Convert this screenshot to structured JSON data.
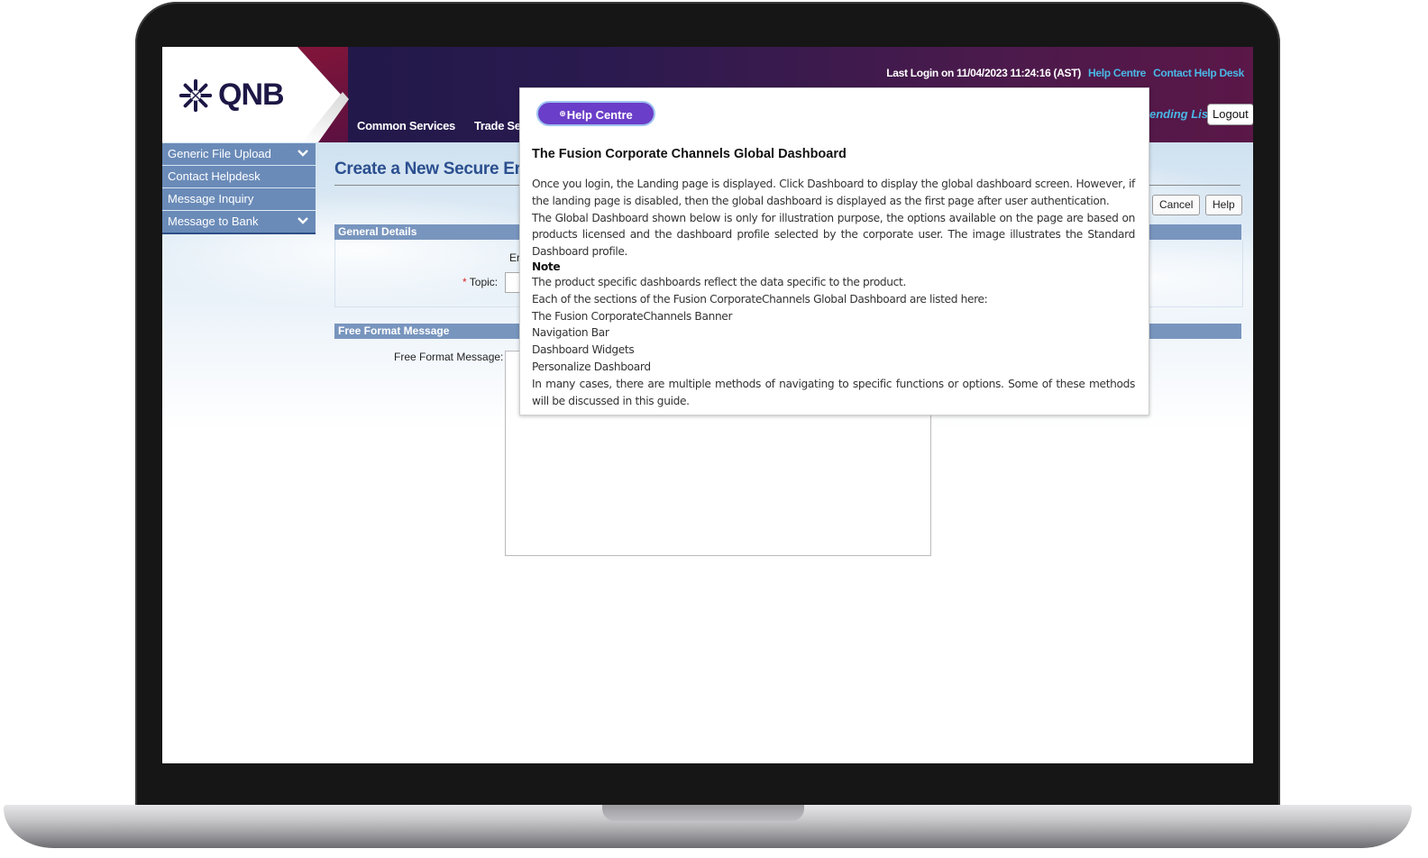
{
  "header": {
    "logo_text": "QNB",
    "last_login": "Last Login on 11/04/2023 11:24:16 (AST)",
    "help_centre_link": "Help Centre",
    "contact_help_desk_link": "Contact Help Desk",
    "nav_items": [
      "Common Services",
      "Trade Serv"
    ],
    "pending_list": "ending List",
    "logout": "Logout"
  },
  "sidebar": {
    "items": [
      {
        "label": "Generic File Upload",
        "has_chevron": true
      },
      {
        "label": "Contact Helpdesk",
        "has_chevron": false
      },
      {
        "label": "Message Inquiry",
        "has_chevron": false
      },
      {
        "label": "Message to Bank",
        "has_chevron": true
      }
    ]
  },
  "main": {
    "title": "Create a New Secure Er",
    "cancel_button": "Cancel",
    "help_button": "Help",
    "general_details": {
      "heading": "General Details",
      "partial_label": "Er",
      "topic_required": "*",
      "topic_label": "Topic:"
    },
    "free_format": {
      "heading": "Free Format Message",
      "label": "Free Format Message:"
    }
  },
  "popup": {
    "pill_label": "Help Centre",
    "title": "The Fusion Corporate Channels Global Dashboard",
    "paragraphs": [
      "Once you login, the Landing page is displayed. Click Dashboard to display the global dashboard screen. However, if the landing page is disabled, then the global dashboard is displayed as the first page after user authentication.",
      "The Global Dashboard shown below is only for illustration purpose, the options available on the page are based on products licensed and the dashboard profile selected by the corporate user. The image illustrates the Standard Dashboard profile."
    ],
    "note_label": "Note",
    "after_note": [
      "The product specific dashboards reflect the data specific to the product.",
      "Each of the sections of the Fusion CorporateChannels Global Dashboard are listed here:",
      "The Fusion CorporateChannels Banner",
      "Navigation Bar",
      "Dashboard Widgets",
      "Personalize Dashboard",
      "In many cases, there are multiple methods of navigating to specific functions or options. Some of these methods will be discussed in this guide."
    ]
  },
  "colors": {
    "header_dark": "#1c1745",
    "header_plum": "#5a1747",
    "link_cyan": "#49b8e6",
    "sidebar_blue": "#6a8bb8",
    "section_bar": "#7895be",
    "pill_purple": "#6a3ec8",
    "title_blue": "#2b4f8f"
  }
}
